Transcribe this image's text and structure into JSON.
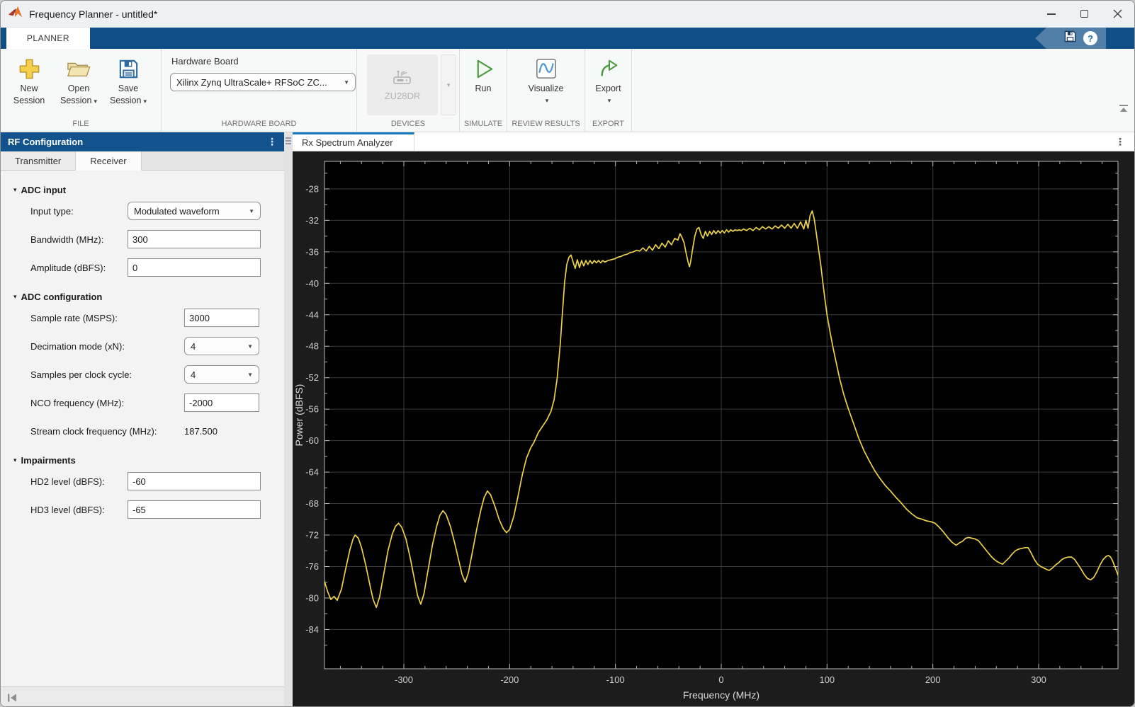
{
  "window": {
    "title": "Frequency Planner - untitled*"
  },
  "ribbon": {
    "tab": "PLANNER",
    "help_glyph": "?"
  },
  "icons": {
    "dots_vertical": "⋮",
    "dropdown_arrow": "▾",
    "combo_arrow": "▼",
    "section_triangle": "▾"
  },
  "toolstrip": {
    "file": {
      "label": "FILE",
      "new_line1": "New",
      "new_line2": "Session",
      "open_line1": "Open",
      "open_line2": "Session",
      "save_line1": "Save",
      "save_line2": "Session"
    },
    "hardware": {
      "label": "HARDWARE BOARD",
      "field_label": "Hardware Board",
      "value": "Xilinx Zynq UltraScale+ RFSoC ZC..."
    },
    "devices": {
      "label": "DEVICES",
      "device": "ZU28DR"
    },
    "simulate": {
      "label": "SIMULATE",
      "run": "Run"
    },
    "review": {
      "label": "REVIEW RESULTS",
      "visualize": "Visualize"
    },
    "export": {
      "label": "EXPORT",
      "export": "Export"
    }
  },
  "left_panel": {
    "header": "RF Configuration",
    "tabs": {
      "transmitter": "Transmitter",
      "receiver": "Receiver"
    },
    "sections": {
      "adc_input": {
        "title": "ADC input",
        "rows": [
          {
            "label": "Input type:",
            "control": "dropdown",
            "value": "Modulated waveform"
          },
          {
            "label": "Bandwidth (MHz):",
            "control": "input",
            "value": "300"
          },
          {
            "label": "Amplitude (dBFS):",
            "control": "input",
            "value": "0"
          }
        ]
      },
      "adc_config": {
        "title": "ADC configuration",
        "rows": [
          {
            "label": "Sample rate (MSPS):",
            "control": "input",
            "value": "3000"
          },
          {
            "label": "Decimation mode (xN):",
            "control": "dropdown",
            "value": "4"
          },
          {
            "label": "Samples per clock cycle:",
            "control": "dropdown",
            "value": "4"
          },
          {
            "label": "NCO frequency (MHz):",
            "control": "input",
            "value": "-2000"
          },
          {
            "label": "Stream clock frequency (MHz):",
            "control": "static",
            "value": "187.500"
          }
        ]
      },
      "impairments": {
        "title": "Impairments",
        "rows": [
          {
            "label": "HD2 level (dBFS):",
            "control": "input",
            "value": "-60"
          },
          {
            "label": "HD3 level (dBFS):",
            "control": "input",
            "value": "-65"
          }
        ]
      }
    }
  },
  "figure": {
    "tab": "Rx Spectrum Analyzer"
  },
  "chart_data": {
    "type": "line",
    "title": "",
    "xlabel": "Frequency (MHz)",
    "ylabel": "Power (dBFS)",
    "xlim": [
      -375,
      375
    ],
    "ylim": [
      -89,
      -24.5
    ],
    "xticks": [
      -300,
      -200,
      -100,
      0,
      100,
      200,
      300
    ],
    "yticks": [
      -28,
      -32,
      -36,
      -40,
      -44,
      -48,
      -52,
      -56,
      -60,
      -64,
      -68,
      -72,
      -76,
      -80,
      -84
    ],
    "x_minor_step": 20,
    "y_minor_step": 2,
    "grid": true,
    "legend": "none",
    "background": "#000000",
    "grid_color": "#3a3a3a",
    "axis_color": "#b8b8b8",
    "tick_label_color": "#cfcfcf",
    "line_color": "#ecd24c",
    "series": [
      {
        "name": "Rx spectrum",
        "points": [
          [
            -375,
            -77.9
          ],
          [
            -372,
            -79.2
          ],
          [
            -369,
            -80.2
          ],
          [
            -366,
            -79.8
          ],
          [
            -363,
            -80.3
          ],
          [
            -359,
            -78.9
          ],
          [
            -355,
            -76.3
          ],
          [
            -351,
            -73.9
          ],
          [
            -348,
            -72.5
          ],
          [
            -346,
            -72.0
          ],
          [
            -343,
            -72.4
          ],
          [
            -340,
            -73.6
          ],
          [
            -336,
            -75.8
          ],
          [
            -332,
            -78.4
          ],
          [
            -329,
            -80.2
          ],
          [
            -326,
            -81.2
          ],
          [
            -323,
            -79.9
          ],
          [
            -319,
            -77.0
          ],
          [
            -315,
            -74.0
          ],
          [
            -311,
            -71.9
          ],
          [
            -308,
            -70.9
          ],
          [
            -305,
            -70.5
          ],
          [
            -302,
            -71.0
          ],
          [
            -298,
            -72.5
          ],
          [
            -294,
            -74.9
          ],
          [
            -290,
            -77.6
          ],
          [
            -287,
            -79.7
          ],
          [
            -284,
            -80.8
          ],
          [
            -281,
            -79.5
          ],
          [
            -277,
            -76.4
          ],
          [
            -273,
            -73.3
          ],
          [
            -269,
            -70.9
          ],
          [
            -266,
            -69.5
          ],
          [
            -263,
            -68.9
          ],
          [
            -260,
            -69.4
          ],
          [
            -256,
            -70.9
          ],
          [
            -252,
            -73.0
          ],
          [
            -248,
            -75.3
          ],
          [
            -245,
            -77.0
          ],
          [
            -242,
            -78.0
          ],
          [
            -239,
            -76.8
          ],
          [
            -235,
            -74.0
          ],
          [
            -231,
            -71.2
          ],
          [
            -227,
            -68.7
          ],
          [
            -224,
            -67.2
          ],
          [
            -221,
            -66.4
          ],
          [
            -218,
            -66.9
          ],
          [
            -214,
            -68.3
          ],
          [
            -210,
            -70.0
          ],
          [
            -206,
            -71.2
          ],
          [
            -203,
            -71.7
          ],
          [
            -200,
            -71.3
          ],
          [
            -196,
            -69.6
          ],
          [
            -192,
            -67.0
          ],
          [
            -188,
            -64.3
          ],
          [
            -184,
            -62.2
          ],
          [
            -180,
            -60.9
          ],
          [
            -177,
            -60.2
          ],
          [
            -173,
            -59.0
          ],
          [
            -169,
            -58.2
          ],
          [
            -165,
            -57.4
          ],
          [
            -161,
            -56.3
          ],
          [
            -158,
            -54.8
          ],
          [
            -155,
            -52.0
          ],
          [
            -152,
            -47.5
          ],
          [
            -150,
            -43.5
          ],
          [
            -148,
            -39.8
          ],
          [
            -146,
            -37.6
          ],
          [
            -144,
            -36.7
          ],
          [
            -142,
            -36.4
          ],
          [
            -140,
            -37.3
          ],
          [
            -138,
            -38.1
          ],
          [
            -136,
            -37.0
          ],
          [
            -134,
            -38.0
          ],
          [
            -132,
            -37.1
          ],
          [
            -130,
            -37.8
          ],
          [
            -128,
            -37.1
          ],
          [
            -126,
            -37.6
          ],
          [
            -124,
            -37.1
          ],
          [
            -122,
            -37.5
          ],
          [
            -120,
            -37.1
          ],
          [
            -118,
            -37.4
          ],
          [
            -116,
            -37.1
          ],
          [
            -114,
            -37.4
          ],
          [
            -112,
            -37.1
          ],
          [
            -110,
            -37.3
          ],
          [
            -107,
            -37.1
          ],
          [
            -104,
            -37.0
          ],
          [
            -101,
            -36.9
          ],
          [
            -98,
            -36.7
          ],
          [
            -95,
            -36.6
          ],
          [
            -92,
            -36.4
          ],
          [
            -89,
            -36.3
          ],
          [
            -86,
            -36.1
          ],
          [
            -83,
            -36.0
          ],
          [
            -80,
            -35.8
          ],
          [
            -77,
            -35.9
          ],
          [
            -74,
            -35.5
          ],
          [
            -71,
            -35.9
          ],
          [
            -68,
            -35.3
          ],
          [
            -65,
            -35.8
          ],
          [
            -62,
            -35.1
          ],
          [
            -59,
            -35.6
          ],
          [
            -56,
            -34.9
          ],
          [
            -53,
            -35.4
          ],
          [
            -50,
            -34.6
          ],
          [
            -47,
            -35.1
          ],
          [
            -44,
            -34.3
          ],
          [
            -41,
            -34.5
          ],
          [
            -39,
            -33.7
          ],
          [
            -37,
            -34.2
          ],
          [
            -35,
            -34.9
          ],
          [
            -33,
            -36.3
          ],
          [
            -31,
            -37.5
          ],
          [
            -30,
            -37.9
          ],
          [
            -29,
            -37.3
          ],
          [
            -27,
            -35.6
          ],
          [
            -25,
            -34.0
          ],
          [
            -23,
            -33.1
          ],
          [
            -21,
            -32.9
          ],
          [
            -19,
            -33.8
          ],
          [
            -17,
            -34.3
          ],
          [
            -15,
            -33.4
          ],
          [
            -13,
            -34.0
          ],
          [
            -11,
            -33.4
          ],
          [
            -9,
            -33.8
          ],
          [
            -7,
            -33.3
          ],
          [
            -5,
            -33.7
          ],
          [
            -3,
            -33.3
          ],
          [
            -1,
            -33.6
          ],
          [
            1,
            -33.3
          ],
          [
            3,
            -33.6
          ],
          [
            5,
            -33.2
          ],
          [
            7,
            -33.5
          ],
          [
            9,
            -33.2
          ],
          [
            11,
            -33.4
          ],
          [
            13,
            -33.2
          ],
          [
            15,
            -33.3
          ],
          [
            17,
            -33.2
          ],
          [
            19,
            -33.3
          ],
          [
            21,
            -33.1
          ],
          [
            24,
            -33.3
          ],
          [
            27,
            -33.0
          ],
          [
            30,
            -33.3
          ],
          [
            33,
            -32.9
          ],
          [
            36,
            -33.2
          ],
          [
            39,
            -32.8
          ],
          [
            42,
            -33.1
          ],
          [
            45,
            -32.8
          ],
          [
            48,
            -33.1
          ],
          [
            51,
            -32.7
          ],
          [
            54,
            -33.0
          ],
          [
            57,
            -32.6
          ],
          [
            60,
            -33.0
          ],
          [
            63,
            -32.5
          ],
          [
            66,
            -33.0
          ],
          [
            69,
            -32.4
          ],
          [
            72,
            -33.0
          ],
          [
            75,
            -32.2
          ],
          [
            78,
            -33.1
          ],
          [
            80,
            -32.0
          ],
          [
            82,
            -33.0
          ],
          [
            84,
            -31.4
          ],
          [
            86,
            -30.8
          ],
          [
            88,
            -31.9
          ],
          [
            90,
            -33.8
          ],
          [
            92,
            -35.7
          ],
          [
            94,
            -37.6
          ],
          [
            96,
            -39.9
          ],
          [
            98,
            -42.0
          ],
          [
            100,
            -44.0
          ],
          [
            103,
            -46.3
          ],
          [
            106,
            -48.4
          ],
          [
            109,
            -50.3
          ],
          [
            112,
            -52.2
          ],
          [
            116,
            -54.2
          ],
          [
            120,
            -55.9
          ],
          [
            125,
            -57.8
          ],
          [
            130,
            -59.7
          ],
          [
            135,
            -61.3
          ],
          [
            140,
            -62.6
          ],
          [
            145,
            -63.8
          ],
          [
            150,
            -64.8
          ],
          [
            155,
            -65.7
          ],
          [
            160,
            -66.4
          ],
          [
            165,
            -67.2
          ],
          [
            170,
            -67.9
          ],
          [
            175,
            -68.7
          ],
          [
            180,
            -69.3
          ],
          [
            185,
            -69.8
          ],
          [
            190,
            -70.0
          ],
          [
            194,
            -70.2
          ],
          [
            198,
            -70.3
          ],
          [
            202,
            -70.5
          ],
          [
            206,
            -71.0
          ],
          [
            210,
            -71.6
          ],
          [
            214,
            -72.3
          ],
          [
            218,
            -72.9
          ],
          [
            222,
            -73.3
          ],
          [
            225,
            -73.0
          ],
          [
            228,
            -72.8
          ],
          [
            231,
            -72.4
          ],
          [
            234,
            -72.3
          ],
          [
            237,
            -72.4
          ],
          [
            240,
            -72.5
          ],
          [
            243,
            -72.7
          ],
          [
            246,
            -73.2
          ],
          [
            249,
            -73.7
          ],
          [
            252,
            -74.2
          ],
          [
            255,
            -74.7
          ],
          [
            258,
            -75.1
          ],
          [
            261,
            -75.4
          ],
          [
            264,
            -75.6
          ],
          [
            266,
            -75.7
          ],
          [
            269,
            -75.3
          ],
          [
            272,
            -74.9
          ],
          [
            275,
            -74.4
          ],
          [
            278,
            -74.0
          ],
          [
            281,
            -73.8
          ],
          [
            284,
            -73.7
          ],
          [
            287,
            -73.6
          ],
          [
            290,
            -73.6
          ],
          [
            293,
            -74.3
          ],
          [
            296,
            -75.1
          ],
          [
            299,
            -75.7
          ],
          [
            302,
            -76.0
          ],
          [
            305,
            -76.2
          ],
          [
            308,
            -76.4
          ],
          [
            310,
            -76.5
          ],
          [
            313,
            -76.2
          ],
          [
            316,
            -75.8
          ],
          [
            319,
            -75.5
          ],
          [
            322,
            -75.1
          ],
          [
            325,
            -74.9
          ],
          [
            328,
            -74.8
          ],
          [
            331,
            -74.8
          ],
          [
            334,
            -75.1
          ],
          [
            337,
            -75.7
          ],
          [
            340,
            -76.3
          ],
          [
            343,
            -77.0
          ],
          [
            346,
            -77.5
          ],
          [
            349,
            -77.7
          ],
          [
            352,
            -77.4
          ],
          [
            355,
            -76.7
          ],
          [
            358,
            -75.8
          ],
          [
            361,
            -75.1
          ],
          [
            364,
            -74.7
          ],
          [
            366,
            -74.6
          ],
          [
            368,
            -74.8
          ],
          [
            370,
            -75.3
          ],
          [
            372,
            -76.0
          ],
          [
            375,
            -77.1
          ]
        ]
      }
    ]
  }
}
